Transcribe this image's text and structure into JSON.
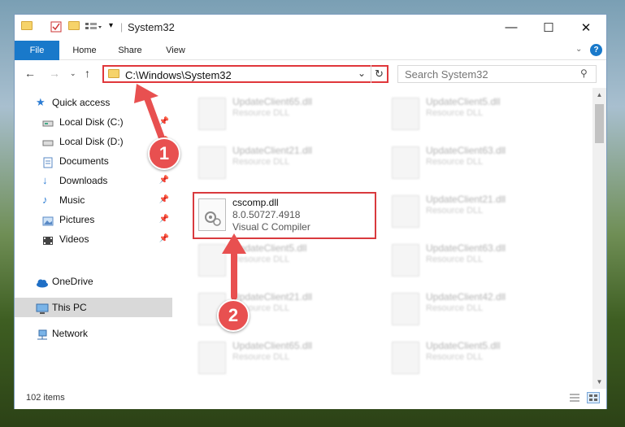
{
  "window": {
    "title": "System32",
    "min_label": "—",
    "max_label": "☐",
    "close_label": "✕"
  },
  "ribbon": {
    "tabs": [
      "File",
      "Home",
      "Share",
      "View"
    ],
    "help_label": "?"
  },
  "address": {
    "path": "C:\\Windows\\System32",
    "search_placeholder": "Search System32"
  },
  "nav": {
    "items": [
      {
        "label": "Quick access",
        "icon": "star-icon"
      },
      {
        "label": "Local Disk (C:)",
        "icon": "drive-icon",
        "pinned": true
      },
      {
        "label": "Local Disk (D:)",
        "icon": "drive-icon",
        "pinned": true
      },
      {
        "label": "Documents",
        "icon": "documents-icon",
        "pinned": true
      },
      {
        "label": "Downloads",
        "icon": "downloads-icon",
        "pinned": true
      },
      {
        "label": "Music",
        "icon": "music-icon",
        "pinned": true
      },
      {
        "label": "Pictures",
        "icon": "pictures-icon",
        "pinned": true
      },
      {
        "label": "Videos",
        "icon": "videos-icon",
        "pinned": true
      },
      {
        "label": "OneDrive",
        "icon": "cloud-icon"
      },
      {
        "label": "This PC",
        "icon": "computer-icon",
        "selected": true
      },
      {
        "label": "Network",
        "icon": "network-icon"
      }
    ]
  },
  "files": {
    "left": [
      {
        "name": "UpdateClient65.dll",
        "desc": "Resource DLL"
      },
      {
        "name": "UpdateClient21.dll",
        "desc": "Resource DLL"
      },
      {
        "name": "cscomp.dll",
        "version": "8.0.50727.4918",
        "desc": "Visual C Compiler"
      },
      {
        "name": "UpdateClient5.dll",
        "desc": "Resource DLL"
      },
      {
        "name": "UpdateClient21.dll",
        "desc": "Resource DLL"
      },
      {
        "name": "UpdateClient65.dll",
        "desc": "Resource DLL"
      }
    ],
    "right": [
      {
        "name": "UpdateClient5.dll",
        "desc": "Resource DLL"
      },
      {
        "name": "UpdateClient63.dll",
        "desc": "Resource DLL"
      },
      {
        "name": "UpdateClient21.dll",
        "desc": "Resource DLL"
      },
      {
        "name": "UpdateClient63.dll",
        "desc": "Resource DLL"
      },
      {
        "name": "UpdateClient42.dll",
        "desc": "Resource DLL"
      },
      {
        "name": "UpdateClient5.dll",
        "desc": "Resource DLL"
      }
    ]
  },
  "status": {
    "item_count": "102 items"
  },
  "markers": [
    {
      "number": "1"
    },
    {
      "number": "2"
    }
  ],
  "colors": {
    "accent": "#1979ca",
    "highlight": "#e0373b",
    "marker": "#e85050"
  }
}
